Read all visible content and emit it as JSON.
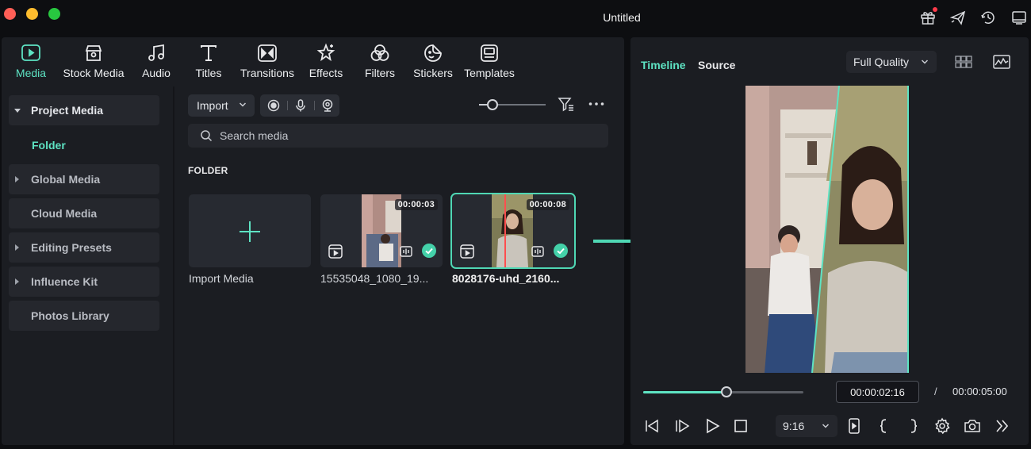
{
  "window": {
    "title": "Untitled"
  },
  "toolbar_tabs": [
    {
      "label": "Media",
      "icon": "media-icon",
      "active": true
    },
    {
      "label": "Stock Media",
      "icon": "stock-media-icon"
    },
    {
      "label": "Audio",
      "icon": "music-note-icon"
    },
    {
      "label": "Titles",
      "icon": "text-t-icon"
    },
    {
      "label": "Transitions",
      "icon": "transitions-icon"
    },
    {
      "label": "Effects",
      "icon": "effects-star-icon"
    },
    {
      "label": "Filters",
      "icon": "filters-icon"
    },
    {
      "label": "Stickers",
      "icon": "sticker-icon"
    },
    {
      "label": "Templates",
      "icon": "templates-icon"
    }
  ],
  "sidebar": {
    "items": [
      {
        "label": "Project Media",
        "caret": "down"
      },
      {
        "label": "Global Media",
        "caret": "right"
      },
      {
        "label": "Cloud Media",
        "caret": "none"
      },
      {
        "label": "Editing Presets",
        "caret": "right"
      },
      {
        "label": "Influence Kit",
        "caret": "right"
      },
      {
        "label": "Photos Library",
        "caret": "none"
      }
    ],
    "subfolder": "Folder"
  },
  "media": {
    "import_label": "Import",
    "search_placeholder": "Search media",
    "section_header": "FOLDER",
    "zoom_level": 0.2,
    "import_tile_label": "Import Media",
    "clips": [
      {
        "name": "15535048_1080_19...",
        "duration": "00:00:03",
        "selected": false
      },
      {
        "name": "8028176-uhd_2160...",
        "duration": "00:00:08",
        "selected": true
      }
    ]
  },
  "preview": {
    "tabs": [
      {
        "label": "Timeline",
        "active": true
      },
      {
        "label": "Source",
        "active": false
      }
    ],
    "quality": "Full Quality",
    "current_time": "00:00:02:16",
    "separator": "/",
    "total_time": "00:00:05:00",
    "progress": 0.52,
    "aspect_ratio": "9:16"
  },
  "colors": {
    "accent": "#5ee3c3",
    "panel": "#1b1d22",
    "background": "#0d0e11"
  }
}
